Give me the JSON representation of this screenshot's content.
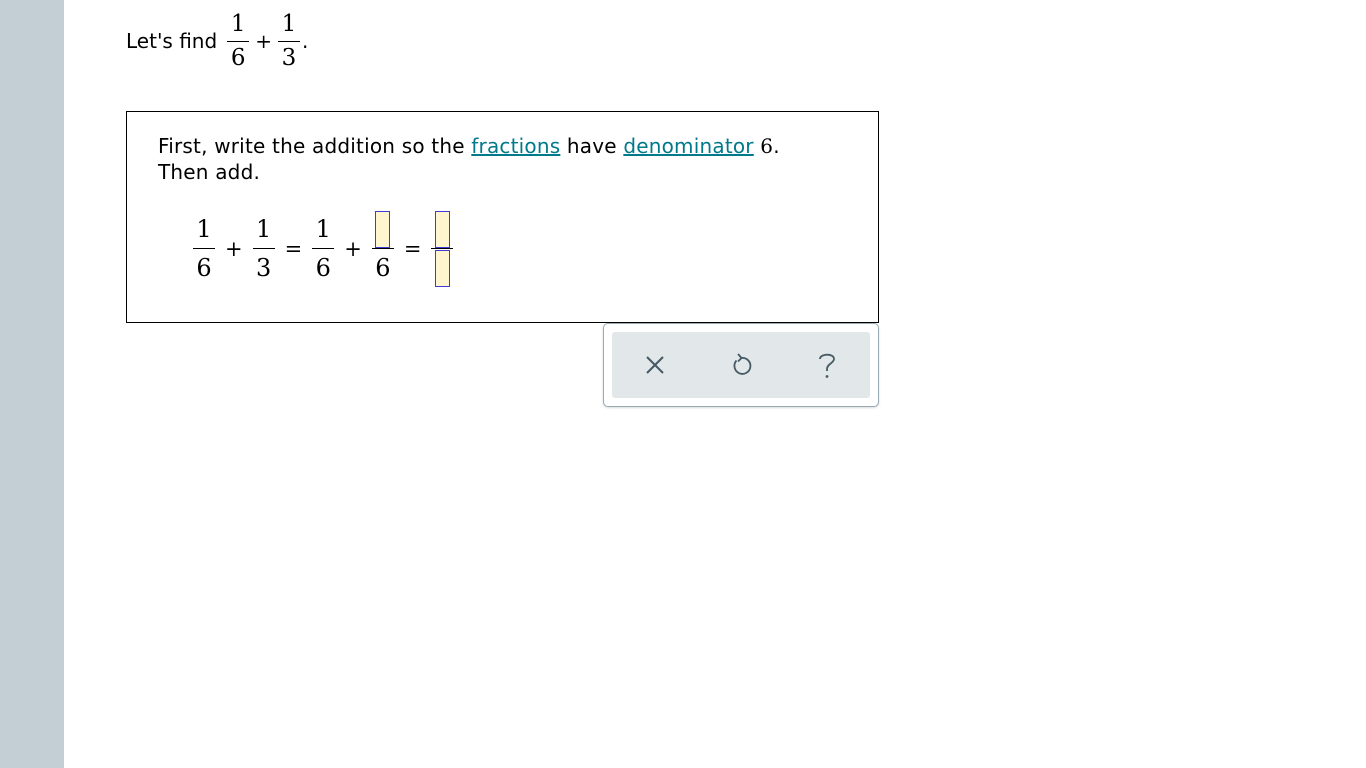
{
  "question": {
    "lead": "Let's find",
    "fraction_a": {
      "numerator": "1",
      "denominator": "6"
    },
    "operator": "+",
    "fraction_b": {
      "numerator": "1",
      "denominator": "3"
    },
    "period": "."
  },
  "step": {
    "text_before_link1": "First, write the addition so the ",
    "link_fractions": "fractions",
    "text_between": " have ",
    "link_denominator": "denominator",
    "target_denominator": "6",
    "line1_end": ".",
    "line2": "Then add.",
    "equation": {
      "term1": {
        "numerator": "1",
        "denominator": "6"
      },
      "plus1": "+",
      "term2": {
        "numerator": "1",
        "denominator": "3"
      },
      "equals1": "=",
      "term3": {
        "numerator": "1",
        "denominator": "6"
      },
      "plus2": "+",
      "term4": {
        "numerator": "",
        "denominator": "6"
      },
      "equals2": "=",
      "result": {
        "numerator": "",
        "denominator": ""
      }
    }
  },
  "toolbar": {
    "clear_icon": "x-icon",
    "undo_icon": "undo-icon",
    "help_icon": "question-mark-icon",
    "icon_color": "#455a64"
  }
}
